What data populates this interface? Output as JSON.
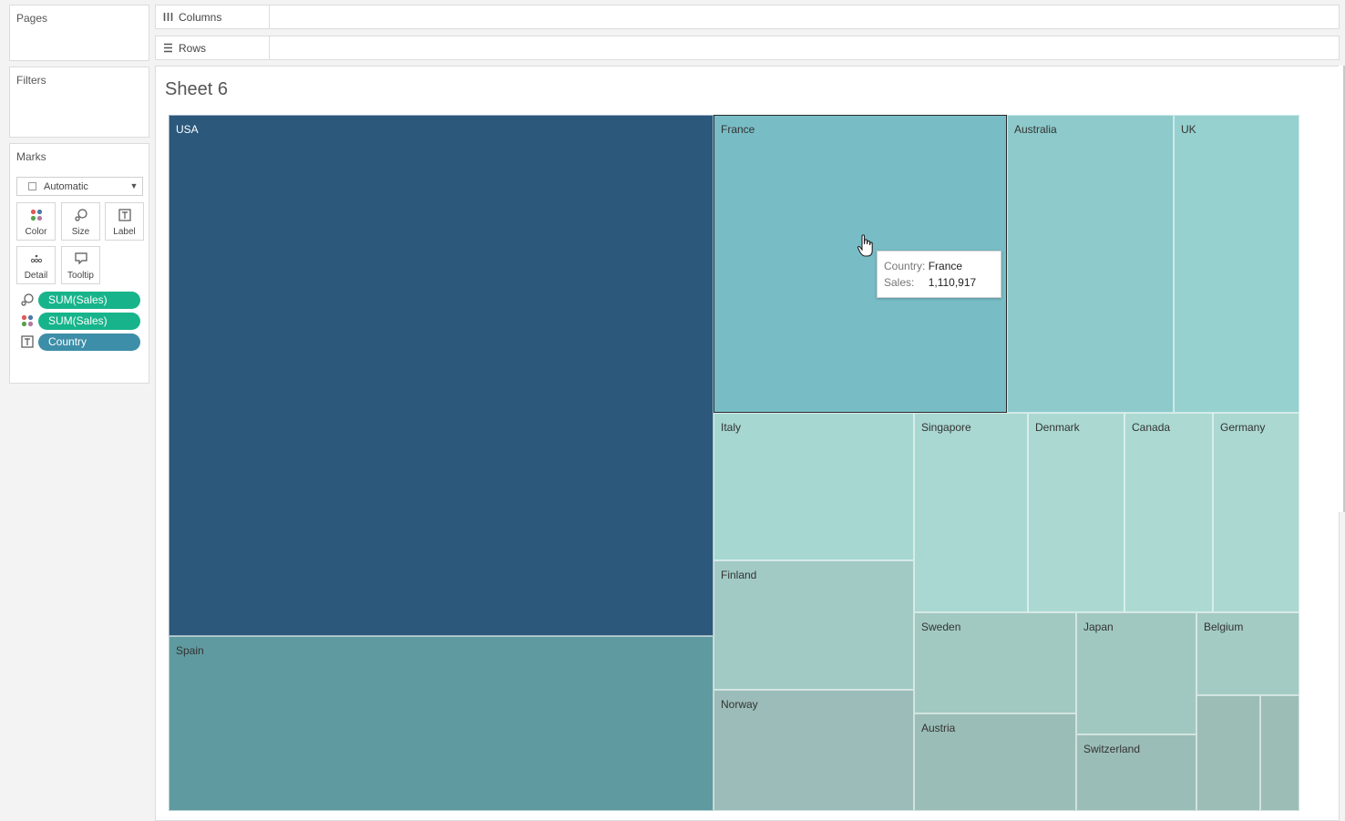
{
  "left_panel": {
    "pages_title": "Pages",
    "filters_title": "Filters",
    "marks": {
      "title": "Marks",
      "mark_type": "Automatic",
      "buttons": [
        {
          "label": "Color",
          "icon": "color-dots-icon"
        },
        {
          "label": "Size",
          "icon": "size-icon"
        },
        {
          "label": "Label",
          "icon": "label-icon"
        },
        {
          "label": "Detail",
          "icon": "detail-icon"
        },
        {
          "label": "Tooltip",
          "icon": "tooltip-icon"
        }
      ],
      "pills": [
        {
          "icon": "size-icon",
          "label": "SUM(Sales)",
          "color": "#17b48b"
        },
        {
          "icon": "color-dots-icon",
          "label": "SUM(Sales)",
          "color": "#17b48b"
        },
        {
          "icon": "label-icon",
          "label": "Country",
          "color": "#3d8ea8"
        }
      ]
    }
  },
  "shelves": {
    "columns_label": "Columns",
    "rows_label": "Rows"
  },
  "sheet": {
    "title": "Sheet 6"
  },
  "chart_data": {
    "type": "treemap",
    "size_measure": "SUM(Sales)",
    "color_measure": "SUM(Sales)",
    "label_dimension": "Country",
    "items": [
      {
        "country": "USA",
        "color": "#2b587b"
      },
      {
        "country": "Spain",
        "color": "#5f9aa0"
      },
      {
        "country": "France",
        "sales": 1110917,
        "color": "#78bdc6"
      },
      {
        "country": "Australia",
        "color": "#8ecacb"
      },
      {
        "country": "UK",
        "color": "#96d1cf"
      },
      {
        "country": "Italy",
        "color": "#a6d7d1"
      },
      {
        "country": "Finland",
        "color": "#a2cac5"
      },
      {
        "country": "Norway",
        "color": "#9bbcb8"
      },
      {
        "country": "Singapore",
        "color": "#a9d7d1"
      },
      {
        "country": "Denmark",
        "color": "#abd9d2"
      },
      {
        "country": "Canada",
        "color": "#acdad3"
      },
      {
        "country": "Germany",
        "color": "#abd8d1"
      },
      {
        "country": "Sweden",
        "color": "#a1c9c2"
      },
      {
        "country": "Austria",
        "color": "#9bbdb7"
      },
      {
        "country": "Japan",
        "color": "#a0c8c1"
      },
      {
        "country": "Switzerland",
        "color": "#9bbdb7"
      },
      {
        "country": "Belgium",
        "color": "#a3cbc4"
      },
      {
        "country": "",
        "color": "#9bbdb6"
      },
      {
        "country": "",
        "color": "#9bbdb6"
      }
    ]
  },
  "tooltip": {
    "country_key": "Country:",
    "country_value": "France",
    "sales_key": "Sales:",
    "sales_value": "1,110,917"
  }
}
